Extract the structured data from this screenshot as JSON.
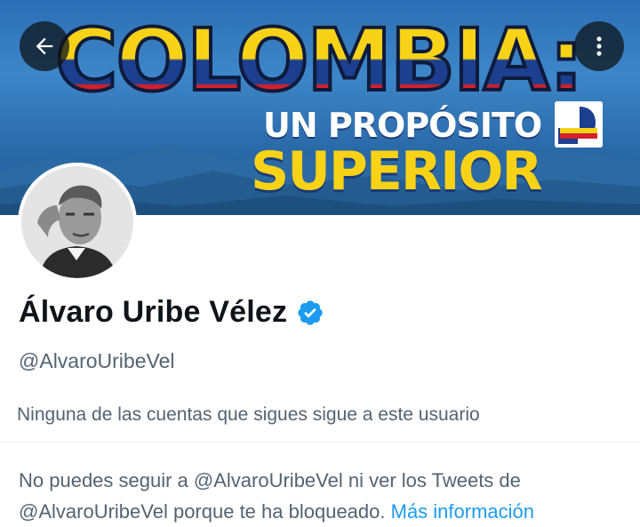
{
  "banner": {
    "headline": "COLOMBIA:",
    "subline_1": "UN PROPÓSITO",
    "subline_2": "SUPERIOR"
  },
  "nav": {
    "back_icon": "arrow-left-icon",
    "more_icon": "more-vertical-icon"
  },
  "profile": {
    "name": "Álvaro Uribe Vélez",
    "verified_icon": "verified-badge-icon",
    "handle": "@AlvaroUribeVel",
    "follow_note": "Ninguna de las cuentas que sigues sigue a este usuario"
  },
  "blocked_notice": {
    "text": "No puedes seguir a @AlvaroUribeVel ni ver los Tweets de @AlvaroUribeVel porque te ha bloqueado.",
    "link_label": "Más información"
  },
  "colors": {
    "verified": "#1d9bf0",
    "link": "#1d9bf0",
    "primary_text": "#0f1419",
    "secondary_text": "#536471"
  }
}
